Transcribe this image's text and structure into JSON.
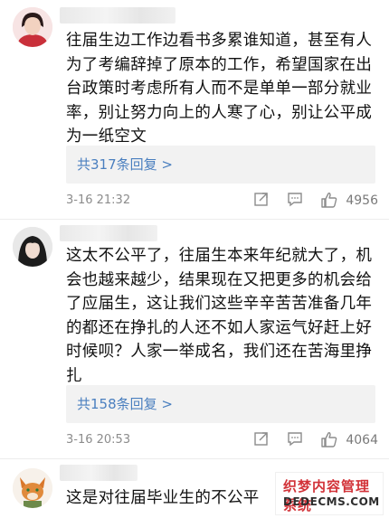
{
  "comments": [
    {
      "text": "往届生边工作边看书多累谁知道，甚至有人为了考编辞掉了原本的工作，希望国家在出台政策时考虑所有人而不是单单一部分就业率，别让努力向上的人寒了心，别让公平成为一纸空文",
      "replies_label": "共317条回复 >",
      "time": "3-16 21:32",
      "likes": "4956"
    },
    {
      "text": "这太不公平了，往届生本来年纪就大了，机会也越来越少，结果现在又把更多的机会给了应届生，这让我们这些辛辛苦苦准备几年的都还在挣扎的人还不如人家运气好赶上好时候呗？人家一举成名，我们还在苦海里挣扎",
      "replies_label": "共158条回复 >",
      "time": "3-16 20:53",
      "likes": "4064"
    },
    {
      "text": "这是对往届毕业生的不公平"
    }
  ],
  "icons": {
    "share": "share-icon",
    "comment": "comment-icon",
    "like": "thumbs-up-icon"
  },
  "watermark": {
    "line1": "织梦内容管理系统",
    "line2": "DEDECMS.COM"
  }
}
